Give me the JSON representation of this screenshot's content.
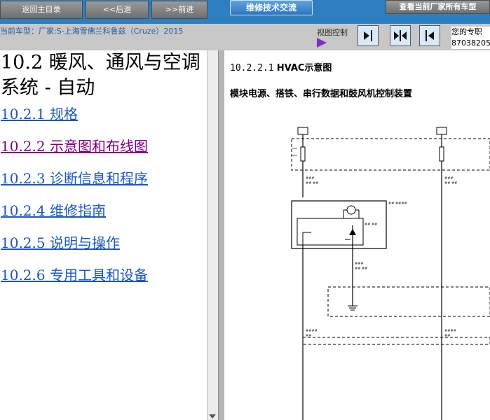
{
  "toolbar": {
    "home_label": "返回主目录",
    "back_label": "<<后退",
    "forward_label": ">>前进",
    "forum_label": "维修技术交流",
    "view_all_label": "查看当前厂家所有车型"
  },
  "subbar": {
    "vehicle_text": "当前车型：厂家:S-上海雪佛兰科鲁兹（Cruze）2015",
    "view_control_label": "视图控制",
    "expert_line1": "您的专职",
    "expert_line2": "87038205"
  },
  "toc": {
    "section_title": "10.2 暖风、通风与空调系统 - 自动",
    "items": [
      {
        "label": "10.2.1 规格"
      },
      {
        "label": "10.2.2 示意图和布线图"
      },
      {
        "label": "10.2.3 诊断信息和程序"
      },
      {
        "label": "10.2.4 维修指南"
      },
      {
        "label": "10.2.5 说明与操作"
      },
      {
        "label": "10.2.6 专用工具和设备"
      }
    ]
  },
  "document": {
    "heading_number": "10.2.2.1",
    "heading_title": "HVAC示意图",
    "subheading": "模块电源、搭铁、串行数据和鼓风机控制装置"
  },
  "colors": {
    "topbar": "#2d7fbf",
    "link": "#1a56c8",
    "visited_link": "#800080",
    "view_control_arrow": "#7a2fc7"
  }
}
